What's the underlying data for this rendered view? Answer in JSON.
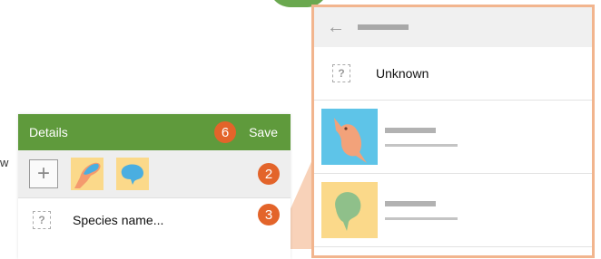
{
  "left_panel": {
    "header": {
      "title": "Details",
      "save_label": "Save",
      "badge": "6"
    },
    "photo_row": {
      "badge": "2"
    },
    "species_row": {
      "label": "Species name...",
      "badge": "3"
    }
  },
  "right_panel": {
    "unknown_label": "Unknown"
  },
  "stray_text": "w",
  "colors": {
    "header_green": "#5f9a3c",
    "badge_orange": "#e3642a",
    "highlight_border": "#f2b58e",
    "thumb_yellow": "#fbd98a",
    "thumb_blue": "#5ec4e8"
  }
}
